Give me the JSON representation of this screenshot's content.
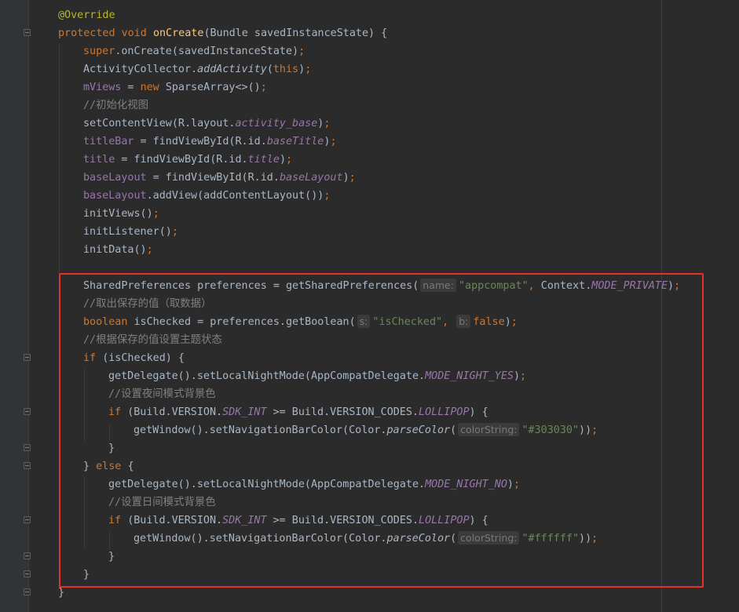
{
  "theme": {
    "background": "#2b2b2b",
    "keyword": "#cc7832",
    "method_decl": "#ffc66d",
    "field": "#9876aa",
    "string": "#6a8759",
    "comment": "#808080",
    "annotation": "#bbb529",
    "highlight_box": "#e53229"
  },
  "lines": [
    [
      {
        "t": "ann",
        "v": "@Override"
      }
    ],
    [
      {
        "t": "kw",
        "v": "protected void "
      },
      {
        "t": "fn",
        "v": "onCreate"
      },
      {
        "t": "",
        "v": "(Bundle savedInstanceState) {"
      }
    ],
    [
      {
        "t": "kw",
        "v": "super"
      },
      {
        "t": "",
        "v": ".onCreate(savedInstanceState)"
      },
      {
        "t": "kw",
        "v": ";"
      }
    ],
    [
      {
        "t": "",
        "v": "ActivityCollector."
      },
      {
        "t": "static",
        "v": "addActivity"
      },
      {
        "t": "",
        "v": "("
      },
      {
        "t": "kw",
        "v": "this"
      },
      {
        "t": "",
        "v": ")"
      },
      {
        "t": "kw",
        "v": ";"
      }
    ],
    [
      {
        "t": "field",
        "v": "mViews"
      },
      {
        "t": "",
        "v": " = "
      },
      {
        "t": "kw",
        "v": "new "
      },
      {
        "t": "",
        "v": "SparseArray<>()"
      },
      {
        "t": "kw",
        "v": ";"
      }
    ],
    [
      {
        "t": "cm",
        "v": "//初始化视图"
      }
    ],
    [
      {
        "t": "",
        "v": "setContentView(R.layout."
      },
      {
        "t": "const",
        "v": "activity_base"
      },
      {
        "t": "",
        "v": ")"
      },
      {
        "t": "kw",
        "v": ";"
      }
    ],
    [
      {
        "t": "field",
        "v": "titleBar"
      },
      {
        "t": "",
        "v": " = findViewById(R.id."
      },
      {
        "t": "const",
        "v": "baseTitle"
      },
      {
        "t": "",
        "v": ")"
      },
      {
        "t": "kw",
        "v": ";"
      }
    ],
    [
      {
        "t": "field",
        "v": "title"
      },
      {
        "t": "",
        "v": " = findViewById(R.id."
      },
      {
        "t": "const",
        "v": "title"
      },
      {
        "t": "",
        "v": ")"
      },
      {
        "t": "kw",
        "v": ";"
      }
    ],
    [
      {
        "t": "field",
        "v": "baseLayout"
      },
      {
        "t": "",
        "v": " = findViewById(R.id."
      },
      {
        "t": "const",
        "v": "baseLayout"
      },
      {
        "t": "",
        "v": ")"
      },
      {
        "t": "kw",
        "v": ";"
      }
    ],
    [
      {
        "t": "field",
        "v": "baseLayout"
      },
      {
        "t": "",
        "v": ".addView(addContentLayout())"
      },
      {
        "t": "kw",
        "v": ";"
      }
    ],
    [
      {
        "t": "",
        "v": "initViews()"
      },
      {
        "t": "kw",
        "v": ";"
      }
    ],
    [
      {
        "t": "",
        "v": "initListener()"
      },
      {
        "t": "kw",
        "v": ";"
      }
    ],
    [
      {
        "t": "",
        "v": "initData()"
      },
      {
        "t": "kw",
        "v": ";"
      }
    ],
    [],
    [
      {
        "t": "",
        "v": "SharedPreferences preferences = getSharedPreferences("
      },
      {
        "t": "hint",
        "v": "name:"
      },
      {
        "t": "str",
        "v": "\"appcompat\""
      },
      {
        "t": "kw",
        "v": ", "
      },
      {
        "t": "",
        "v": "Context."
      },
      {
        "t": "const",
        "v": "MODE_PRIVATE"
      },
      {
        "t": "",
        "v": ")"
      },
      {
        "t": "kw",
        "v": ";"
      }
    ],
    [
      {
        "t": "cm",
        "v": "//取出保存的值（取数据）"
      }
    ],
    [
      {
        "t": "kw",
        "v": "boolean "
      },
      {
        "t": "",
        "v": "isChecked = preferences.getBoolean("
      },
      {
        "t": "hint",
        "v": "s:"
      },
      {
        "t": "str",
        "v": "\"isChecked\""
      },
      {
        "t": "kw",
        "v": ", "
      },
      {
        "t": "hint",
        "v": "b:"
      },
      {
        "t": "kw",
        "v": "false"
      },
      {
        "t": "",
        "v": ")"
      },
      {
        "t": "kw",
        "v": ";"
      }
    ],
    [
      {
        "t": "cm",
        "v": "//根据保存的值设置主题状态"
      }
    ],
    [
      {
        "t": "kw",
        "v": "if "
      },
      {
        "t": "",
        "v": "(isChecked) {"
      }
    ],
    [
      {
        "t": "",
        "v": "getDelegate().setLocalNightMode(AppCompatDelegate."
      },
      {
        "t": "const",
        "v": "MODE_NIGHT_YES"
      },
      {
        "t": "",
        "v": ")"
      },
      {
        "t": "kw",
        "v": ";"
      }
    ],
    [
      {
        "t": "cm",
        "v": "//设置夜间模式背景色"
      }
    ],
    [
      {
        "t": "kw",
        "v": "if "
      },
      {
        "t": "",
        "v": "(Build.VERSION."
      },
      {
        "t": "const",
        "v": "SDK_INT"
      },
      {
        "t": "",
        "v": " >= Build.VERSION_CODES."
      },
      {
        "t": "const",
        "v": "LOLLIPOP"
      },
      {
        "t": "",
        "v": ") {"
      }
    ],
    [
      {
        "t": "",
        "v": "getWindow().setNavigationBarColor(Color."
      },
      {
        "t": "static",
        "v": "parseColor"
      },
      {
        "t": "",
        "v": "("
      },
      {
        "t": "hint",
        "v": "colorString:"
      },
      {
        "t": "str",
        "v": "\"#303030\""
      },
      {
        "t": "",
        "v": "))"
      },
      {
        "t": "kw",
        "v": ";"
      }
    ],
    [
      {
        "t": "",
        "v": "}"
      }
    ],
    [
      {
        "t": "",
        "v": "} "
      },
      {
        "t": "kw",
        "v": "else "
      },
      {
        "t": "",
        "v": "{"
      }
    ],
    [
      {
        "t": "",
        "v": "getDelegate().setLocalNightMode(AppCompatDelegate."
      },
      {
        "t": "const",
        "v": "MODE_NIGHT_NO"
      },
      {
        "t": "",
        "v": ")"
      },
      {
        "t": "kw",
        "v": ";"
      }
    ],
    [
      {
        "t": "cm",
        "v": "//设置日间模式背景色"
      }
    ],
    [
      {
        "t": "kw",
        "v": "if "
      },
      {
        "t": "",
        "v": "(Build.VERSION."
      },
      {
        "t": "const",
        "v": "SDK_INT"
      },
      {
        "t": "",
        "v": " >= Build.VERSION_CODES."
      },
      {
        "t": "const",
        "v": "LOLLIPOP"
      },
      {
        "t": "",
        "v": ") {"
      }
    ],
    [
      {
        "t": "",
        "v": "getWindow().setNavigationBarColor(Color."
      },
      {
        "t": "static",
        "v": "parseColor"
      },
      {
        "t": "",
        "v": "("
      },
      {
        "t": "hint",
        "v": "colorString:"
      },
      {
        "t": "str",
        "v": "\"#ffffff\""
      },
      {
        "t": "",
        "v": "))"
      },
      {
        "t": "kw",
        "v": ";"
      }
    ],
    [
      {
        "t": "",
        "v": "}"
      }
    ],
    [
      {
        "t": "",
        "v": "}"
      }
    ],
    [
      {
        "t": "",
        "v": "}"
      }
    ]
  ]
}
